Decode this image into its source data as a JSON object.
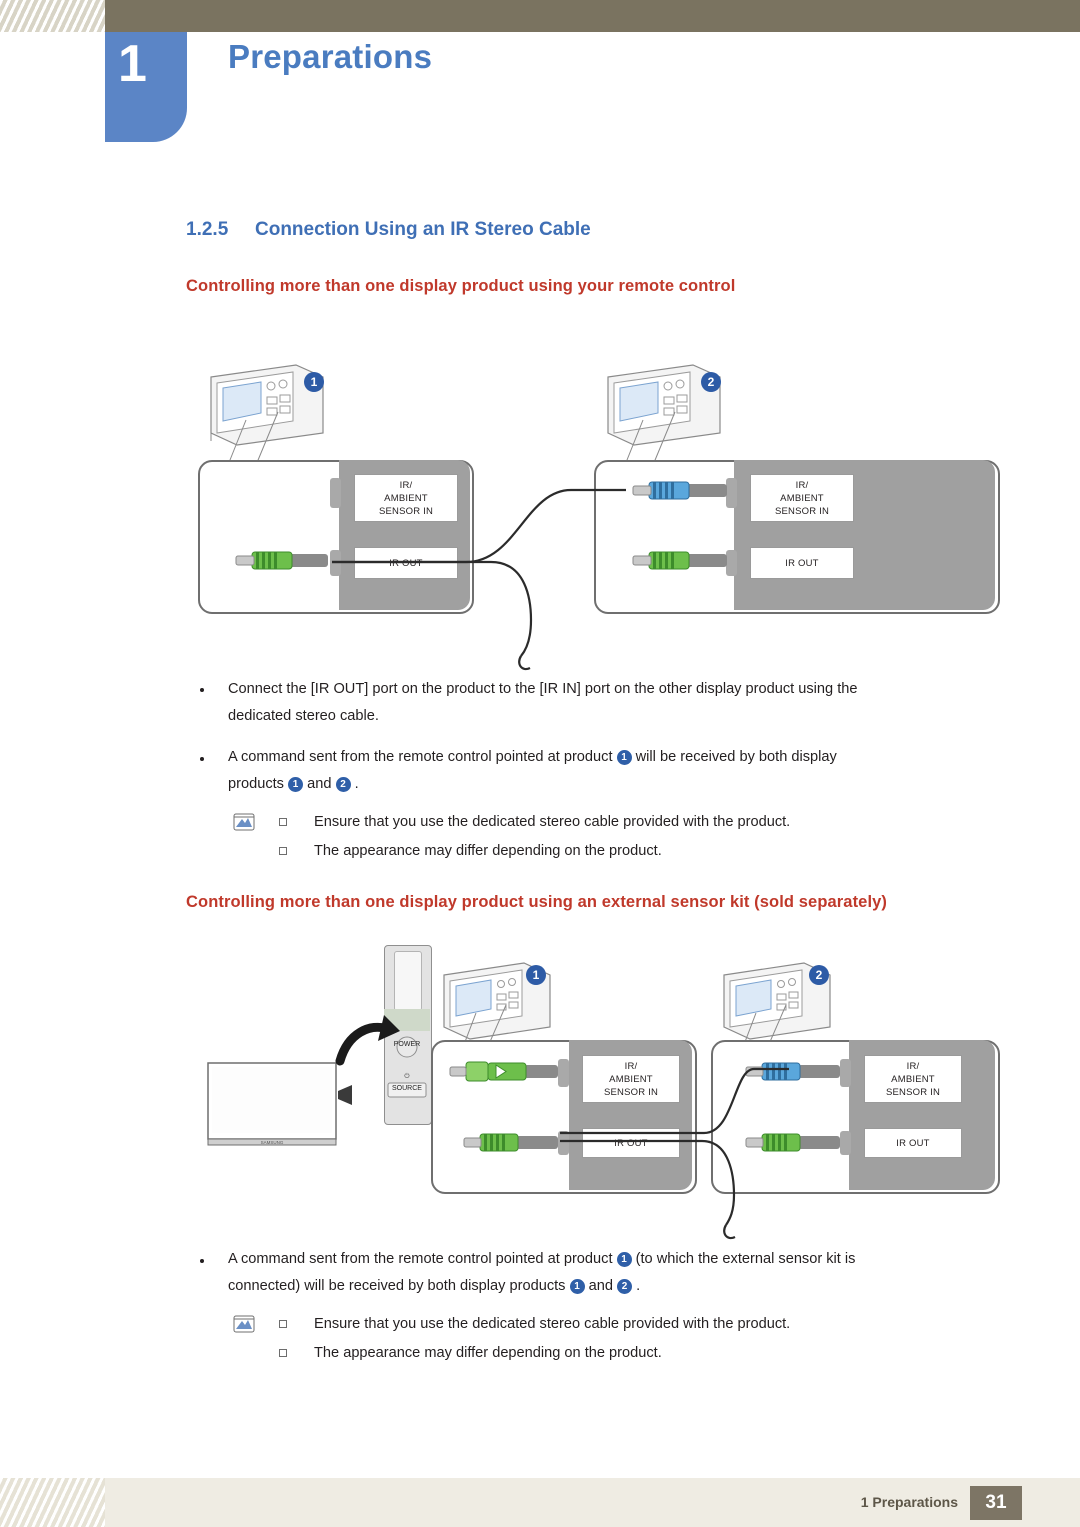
{
  "header": {
    "chapter_number": "1",
    "chapter_title": "Preparations"
  },
  "section": {
    "number": "1.2.5",
    "title": "Connection Using an IR Stereo Cable"
  },
  "sub_headings": {
    "one": "Controlling more than one display product using your remote control",
    "two": "Controlling more than one display product using an external sensor kit (sold separately)"
  },
  "diagram1": {
    "left_product": {
      "ir_in_label_line1": "IR/",
      "ir_in_label_line2": "AMBIENT",
      "ir_in_label_line3": "SENSOR IN",
      "ir_out_label": "IR OUT",
      "badge": "1"
    },
    "right_product": {
      "ir_in_label_line1": "IR/",
      "ir_in_label_line2": "AMBIENT",
      "ir_in_label_line3": "SENSOR IN",
      "ir_out_label": "IR OUT",
      "badge": "2"
    }
  },
  "diagram2": {
    "sensor_kit": {
      "power_label": "POWER",
      "source_label": "SOURCE",
      "power_symbol": "⏻"
    },
    "left_product": {
      "ir_in_label_line1": "IR/",
      "ir_in_label_line2": "AMBIENT",
      "ir_in_label_line3": "SENSOR IN",
      "ir_out_label": "IR OUT",
      "badge": "1"
    },
    "right_product": {
      "ir_in_label_line1": "IR/",
      "ir_in_label_line2": "AMBIENT",
      "ir_in_label_line3": "SENSOR IN",
      "ir_out_label": "IR OUT",
      "badge": "2"
    },
    "brand": "SAMSUNG"
  },
  "body": {
    "bullet1_line1": "Connect the [IR OUT] port on the product to the [IR IN] port on the other display product using the",
    "bullet1_line2": "dedicated stereo cable.",
    "bullet2_part1": "A command sent from the remote control pointed at product",
    "bullet2_badge1": "1",
    "bullet2_part2": "will be received by both display",
    "bullet2_part3": "products",
    "bullet2_badge2": "1",
    "bullet2_part4": "and",
    "bullet2_badge3": "2",
    "bullet2_part5": ".",
    "note1_line1": "Ensure that you use the dedicated stereo cable provided with the product.",
    "note1_line2": "The appearance may differ depending on the product.",
    "bullet3_part1": "A command sent from the remote control pointed at product",
    "bullet3_badge1": "1",
    "bullet3_part2": "(to which the external sensor kit is",
    "bullet3_part3": "connected) will be received by both display products",
    "bullet3_badge2": "1",
    "bullet3_part4": "and",
    "bullet3_badge3": "2",
    "bullet3_part5": ".",
    "note2_line1": "Ensure that you use the dedicated stereo cable provided with the product.",
    "note2_line2": "The appearance may differ depending on the product."
  },
  "footer": {
    "chapter": "1 Preparations",
    "page": "31"
  },
  "colors": {
    "header_band": "#7a7360",
    "badge_blue": "#5b85c6",
    "heading_blue": "#3f6fb5",
    "heading_red": "#c0392b",
    "footer_band": "#efece3"
  }
}
